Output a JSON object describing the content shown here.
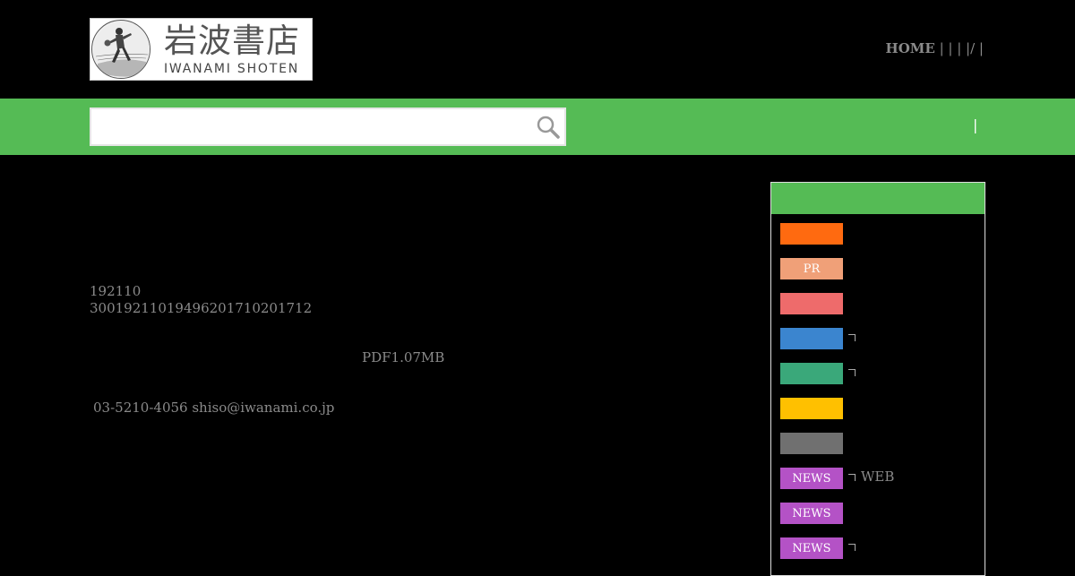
{
  "logo": {
    "kanji": "岩波書店",
    "roman": "IWANAMI  SHOTEN"
  },
  "topnav": {
    "home": "HOME",
    "rest": " | | | |/ |"
  },
  "search": {
    "value": "",
    "placeholder": ""
  },
  "band": {
    "divider": "|"
  },
  "main": {
    "line1": "192110",
    "line2": "3001921101949620171020171 2",
    "pdf": "PDF1.07MB",
    "contact": "03-5210-4056 shiso@iwanami.co.jp"
  },
  "sidebar": {
    "items": [
      {
        "label": "",
        "color": "#ff6a10",
        "corner": false,
        "text": ""
      },
      {
        "label": "PR",
        "color": "#f0a078",
        "corner": false,
        "text": ""
      },
      {
        "label": "",
        "color": "#ee6b6b",
        "corner": false,
        "text": ""
      },
      {
        "label": "",
        "color": "#3b85cf",
        "corner": true,
        "text": ""
      },
      {
        "label": "",
        "color": "#3aa87a",
        "corner": true,
        "text": ""
      },
      {
        "label": "",
        "color": "#ffc000",
        "corner": false,
        "text": ""
      },
      {
        "label": "",
        "color": "#707070",
        "corner": false,
        "text": ""
      },
      {
        "label": "NEWS",
        "color": "#b452c6",
        "corner": true,
        "text": "WEB"
      },
      {
        "label": "NEWS",
        "color": "#b452c6",
        "corner": false,
        "text": ""
      },
      {
        "label": "NEWS",
        "color": "#b452c6",
        "corner": true,
        "text": ""
      }
    ]
  }
}
